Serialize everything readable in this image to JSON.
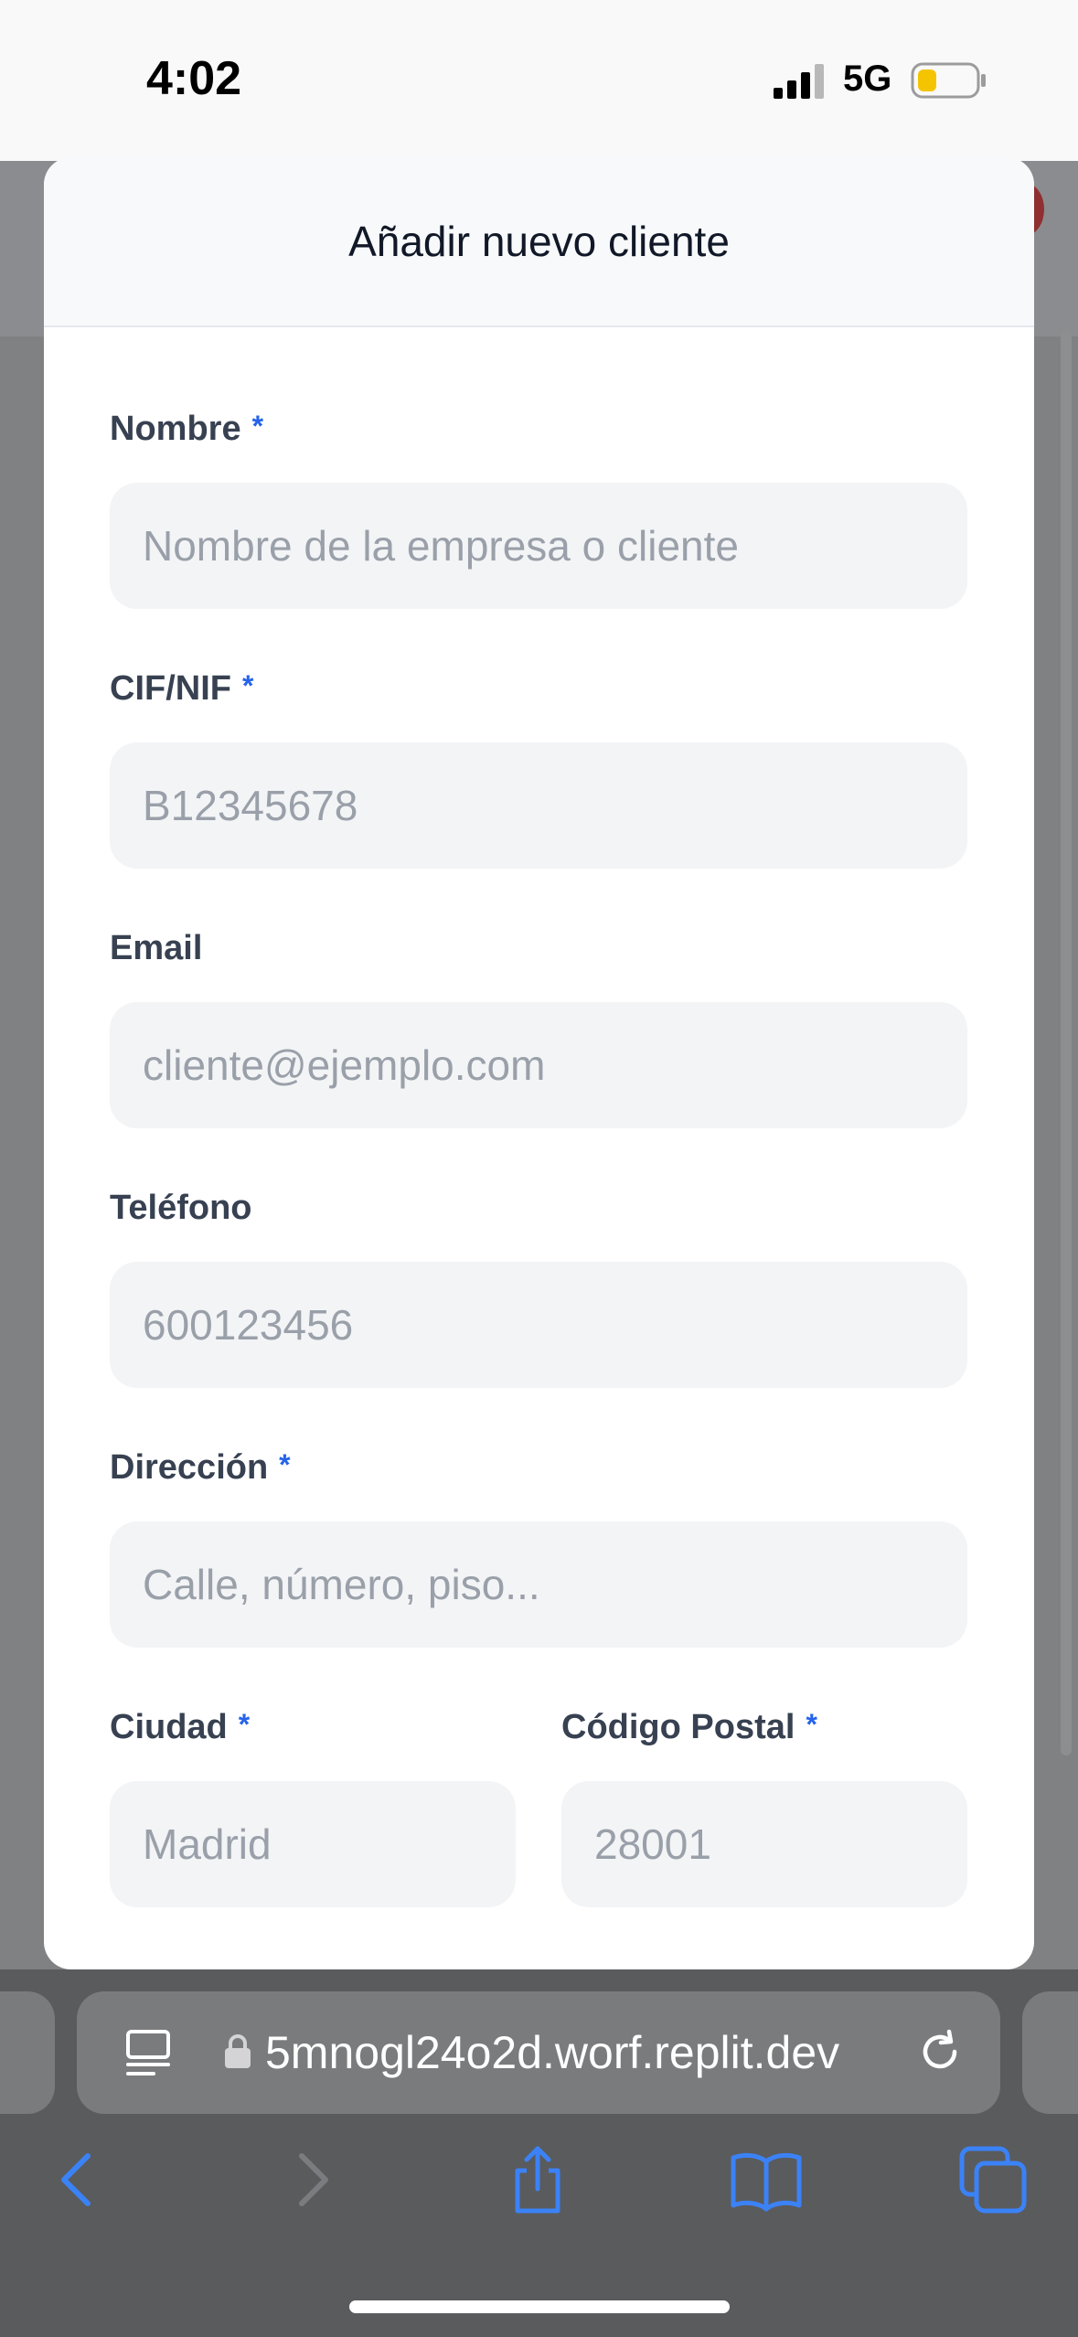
{
  "status_bar": {
    "time": "4:02",
    "network": "5G",
    "battery_color": "#f5c400"
  },
  "modal": {
    "title": "Añadir nuevo cliente",
    "required_mark": "*",
    "fields": {
      "nombre": {
        "label": "Nombre",
        "placeholder": "Nombre de la empresa o cliente",
        "required": true
      },
      "cif": {
        "label": "CIF/NIF",
        "placeholder": "B12345678",
        "required": true
      },
      "email": {
        "label": "Email",
        "placeholder": "cliente@ejemplo.com",
        "required": false
      },
      "telefono": {
        "label": "Teléfono",
        "placeholder": "600123456",
        "required": false
      },
      "direccion": {
        "label": "Dirección",
        "placeholder": "Calle, número, piso...",
        "required": true
      },
      "ciudad": {
        "label": "Ciudad",
        "placeholder": "Madrid",
        "required": true
      },
      "codigo_postal": {
        "label": "Código Postal",
        "placeholder": "28001",
        "required": true
      }
    }
  },
  "browser": {
    "url": "5mnogl24o2d.worf.replit.dev",
    "icons": {
      "reader": "reader-mode-icon",
      "lock": "lock-icon",
      "reload": "reload-icon",
      "back": "back-icon",
      "forward": "forward-icon",
      "share": "share-icon",
      "bookmarks": "bookmarks-icon",
      "tabs": "tabs-icon"
    },
    "accent": "#3b82f6"
  }
}
